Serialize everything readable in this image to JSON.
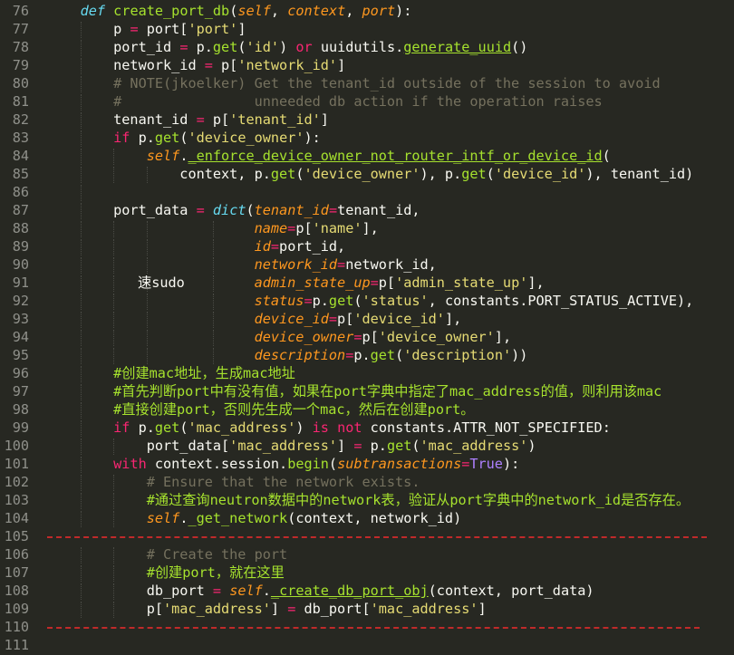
{
  "editor": {
    "theme": {
      "background": "#272822",
      "line_number": "#8f908a",
      "keyword": "#f92672",
      "function": "#a6e22e",
      "string": "#e6db74",
      "comment": "#75715e",
      "self_param": "#fd971f",
      "constant": "#ae81ff",
      "ruler": "#c02a2a"
    },
    "lines": [
      {
        "n": "76",
        "i": 1,
        "t": [
          [
            "    ",
            ""
          ],
          [
            "def",
            "st"
          ],
          [
            " ",
            ""
          ],
          [
            "create_port_db",
            "fn"
          ],
          [
            "(",
            ""
          ],
          [
            "self",
            "param"
          ],
          [
            ", ",
            ""
          ],
          [
            "context",
            "param"
          ],
          [
            ", ",
            ""
          ],
          [
            "port",
            "param"
          ],
          [
            "):",
            ""
          ]
        ]
      },
      {
        "n": "77",
        "i": 2,
        "t": [
          [
            "        p ",
            ""
          ],
          [
            "=",
            "sym"
          ],
          [
            " port[",
            ""
          ],
          [
            "'port'",
            "str"
          ],
          [
            "]",
            ""
          ]
        ]
      },
      {
        "n": "78",
        "i": 2,
        "t": [
          [
            "        port_id ",
            ""
          ],
          [
            "=",
            "sym"
          ],
          [
            " p.",
            ""
          ],
          [
            "get",
            "fn"
          ],
          [
            "(",
            ""
          ],
          [
            "'id'",
            "str"
          ],
          [
            ") ",
            ""
          ],
          [
            "or",
            "kw"
          ],
          [
            " uuidutils.",
            ""
          ],
          [
            "generate_uuid",
            "ucall"
          ],
          [
            "()",
            ""
          ]
        ]
      },
      {
        "n": "79",
        "i": 2,
        "t": [
          [
            "        network_id ",
            ""
          ],
          [
            "=",
            "sym"
          ],
          [
            " p[",
            ""
          ],
          [
            "'network_id'",
            "str"
          ],
          [
            "]",
            ""
          ]
        ]
      },
      {
        "n": "80",
        "i": 2,
        "t": [
          [
            "        # NOTE(jkoelker) Get the tenant_id outside of the session to avoid",
            "cm"
          ]
        ]
      },
      {
        "n": "81",
        "i": 2,
        "t": [
          [
            "        #                unneeded db action if the operation raises",
            "cm"
          ]
        ]
      },
      {
        "n": "82",
        "i": 2,
        "t": [
          [
            "        tenant_id ",
            ""
          ],
          [
            "=",
            "sym"
          ],
          [
            " p[",
            ""
          ],
          [
            "'tenant_id'",
            "str"
          ],
          [
            "]",
            ""
          ]
        ]
      },
      {
        "n": "83",
        "i": 2,
        "t": [
          [
            "        ",
            ""
          ],
          [
            "if",
            "kw"
          ],
          [
            " p.",
            ""
          ],
          [
            "get",
            "fn"
          ],
          [
            "(",
            ""
          ],
          [
            "'device_owner'",
            "str"
          ],
          [
            "):",
            ""
          ]
        ]
      },
      {
        "n": "84",
        "i": 3,
        "t": [
          [
            "            ",
            ""
          ],
          [
            "self",
            "self"
          ],
          [
            ".",
            ""
          ],
          [
            "_enforce_device_owner_not_router_intf_or_device_id",
            "ucall"
          ],
          [
            "(",
            ""
          ]
        ]
      },
      {
        "n": "85",
        "i": 4,
        "t": [
          [
            "                context, p.",
            ""
          ],
          [
            "get",
            "fn"
          ],
          [
            "(",
            ""
          ],
          [
            "'device_owner'",
            "str"
          ],
          [
            "), p.",
            ""
          ],
          [
            "get",
            "fn"
          ],
          [
            "(",
            ""
          ],
          [
            "'device_id'",
            "str"
          ],
          [
            "), tenant_id)",
            ""
          ]
        ]
      },
      {
        "n": "86",
        "i": 2,
        "t": []
      },
      {
        "n": "87",
        "i": 2,
        "t": [
          [
            "        port_data ",
            ""
          ],
          [
            "=",
            "sym"
          ],
          [
            " ",
            ""
          ],
          [
            "dict",
            "st"
          ],
          [
            "(",
            ""
          ],
          [
            "tenant_id",
            "kwarg"
          ],
          [
            "=",
            "sym"
          ],
          [
            "tenant_id,",
            ""
          ]
        ]
      },
      {
        "n": "88",
        "i": 6,
        "t": [
          [
            "                         ",
            ""
          ],
          [
            "name",
            "kwarg"
          ],
          [
            "=",
            "sym"
          ],
          [
            "p[",
            ""
          ],
          [
            "'name'",
            "str"
          ],
          [
            "],",
            ""
          ]
        ]
      },
      {
        "n": "89",
        "i": 6,
        "t": [
          [
            "                         ",
            ""
          ],
          [
            "id",
            "kwarg"
          ],
          [
            "=",
            "sym"
          ],
          [
            "port_id,",
            ""
          ]
        ]
      },
      {
        "n": "90",
        "i": 6,
        "t": [
          [
            "                         ",
            ""
          ],
          [
            "network_id",
            "kwarg"
          ],
          [
            "=",
            "sym"
          ],
          [
            "network_id,",
            ""
          ]
        ]
      },
      {
        "n": "91",
        "i": 6,
        "t": [
          [
            "                         ",
            ""
          ],
          [
            "admin_state_up",
            "kwarg"
          ],
          [
            "=",
            "sym"
          ],
          [
            "p[",
            ""
          ],
          [
            "'admin_state_up'",
            "str"
          ],
          [
            "],",
            ""
          ]
        ]
      },
      {
        "n": "92",
        "i": 6,
        "t": [
          [
            "                         ",
            ""
          ],
          [
            "status",
            "kwarg"
          ],
          [
            "=",
            "sym"
          ],
          [
            "p.",
            ""
          ],
          [
            "get",
            "fn"
          ],
          [
            "(",
            ""
          ],
          [
            "'status'",
            "str"
          ],
          [
            ", constants.PORT_STATUS_ACTIVE),",
            ""
          ]
        ]
      },
      {
        "n": "93",
        "i": 6,
        "t": [
          [
            "                         ",
            ""
          ],
          [
            "device_id",
            "kwarg"
          ],
          [
            "=",
            "sym"
          ],
          [
            "p[",
            ""
          ],
          [
            "'device_id'",
            "str"
          ],
          [
            "],",
            ""
          ]
        ]
      },
      {
        "n": "94",
        "i": 6,
        "t": [
          [
            "                         ",
            ""
          ],
          [
            "device_owner",
            "kwarg"
          ],
          [
            "=",
            "sym"
          ],
          [
            "p[",
            ""
          ],
          [
            "'device_owner'",
            "str"
          ],
          [
            "],",
            ""
          ]
        ]
      },
      {
        "n": "95",
        "i": 6,
        "t": [
          [
            "                         ",
            ""
          ],
          [
            "description",
            "kwarg"
          ],
          [
            "=",
            "sym"
          ],
          [
            "p.",
            ""
          ],
          [
            "get",
            "fn"
          ],
          [
            "(",
            ""
          ],
          [
            "'description'",
            "str"
          ],
          [
            "))",
            ""
          ]
        ]
      },
      {
        "n": "96",
        "i": 2,
        "t": [
          [
            "        #创建mac地址，生成mac地址",
            "cmz"
          ]
        ]
      },
      {
        "n": "97",
        "i": 2,
        "t": [
          [
            "        #首先判断port中有没有值，如果在port字典中指定了mac_address的值，则利用该mac",
            "cmz"
          ]
        ]
      },
      {
        "n": "98",
        "i": 2,
        "t": [
          [
            "        #直接创建port，否则先生成一个mac，然后在创建port。",
            "cmz"
          ]
        ]
      },
      {
        "n": "99",
        "i": 2,
        "t": [
          [
            "        ",
            ""
          ],
          [
            "if",
            "kw"
          ],
          [
            " p.",
            ""
          ],
          [
            "get",
            "fn"
          ],
          [
            "(",
            ""
          ],
          [
            "'mac_address'",
            "str"
          ],
          [
            ") ",
            ""
          ],
          [
            "is not",
            "kw"
          ],
          [
            " constants.ATTR_NOT_SPECIFIED:",
            ""
          ]
        ]
      },
      {
        "n": "100",
        "i": 3,
        "t": [
          [
            "            port_data[",
            ""
          ],
          [
            "'mac_address'",
            "str"
          ],
          [
            "] ",
            ""
          ],
          [
            "=",
            "sym"
          ],
          [
            " p.",
            ""
          ],
          [
            "get",
            "fn"
          ],
          [
            "(",
            ""
          ],
          [
            "'mac_address'",
            "str"
          ],
          [
            ")",
            ""
          ]
        ]
      },
      {
        "n": "101",
        "i": 2,
        "t": [
          [
            "        ",
            ""
          ],
          [
            "with",
            "kw"
          ],
          [
            " context.session.",
            ""
          ],
          [
            "begin",
            "fn"
          ],
          [
            "(",
            ""
          ],
          [
            "subtransactions",
            "kwarg"
          ],
          [
            "=",
            "sym"
          ],
          [
            "True",
            "const"
          ],
          [
            "):",
            ""
          ]
        ]
      },
      {
        "n": "102",
        "i": 3,
        "t": [
          [
            "            # Ensure that the network exists.",
            "cm"
          ]
        ]
      },
      {
        "n": "103",
        "i": 3,
        "t": [
          [
            "            #通过查询neutron数据中的network表，验证从port字典中的network_id是否存在。",
            "cmz"
          ]
        ]
      },
      {
        "n": "104",
        "i": 3,
        "t": [
          [
            "            ",
            ""
          ],
          [
            "self",
            "self"
          ],
          [
            ".",
            ""
          ],
          [
            "_get_network",
            "fn"
          ],
          [
            "(context, network_id)",
            ""
          ]
        ]
      },
      {
        "n": "105",
        "i": 0,
        "t": []
      },
      {
        "n": "106",
        "i": 3,
        "t": [
          [
            "            # Create the port",
            "cm"
          ]
        ]
      },
      {
        "n": "107",
        "i": 3,
        "t": [
          [
            "            #创建port，就在这里",
            "cmz"
          ]
        ]
      },
      {
        "n": "108",
        "i": 3,
        "t": [
          [
            "            db_port ",
            ""
          ],
          [
            "=",
            "sym"
          ],
          [
            " ",
            ""
          ],
          [
            "self",
            "self"
          ],
          [
            ".",
            ""
          ],
          [
            "_create_db_port_obj",
            "ucall"
          ],
          [
            "(context, port_data)",
            ""
          ]
        ]
      },
      {
        "n": "109",
        "i": 3,
        "t": [
          [
            "            p[",
            ""
          ],
          [
            "'mac_address'",
            "str"
          ],
          [
            "] ",
            ""
          ],
          [
            "=",
            "sym"
          ],
          [
            " db_port[",
            ""
          ],
          [
            "'mac_address'",
            "str"
          ],
          [
            "]",
            ""
          ]
        ]
      },
      {
        "n": "110",
        "i": 0,
        "t": []
      },
      {
        "n": "111",
        "i": 0,
        "t": []
      }
    ],
    "floating_text": "速sudo"
  }
}
